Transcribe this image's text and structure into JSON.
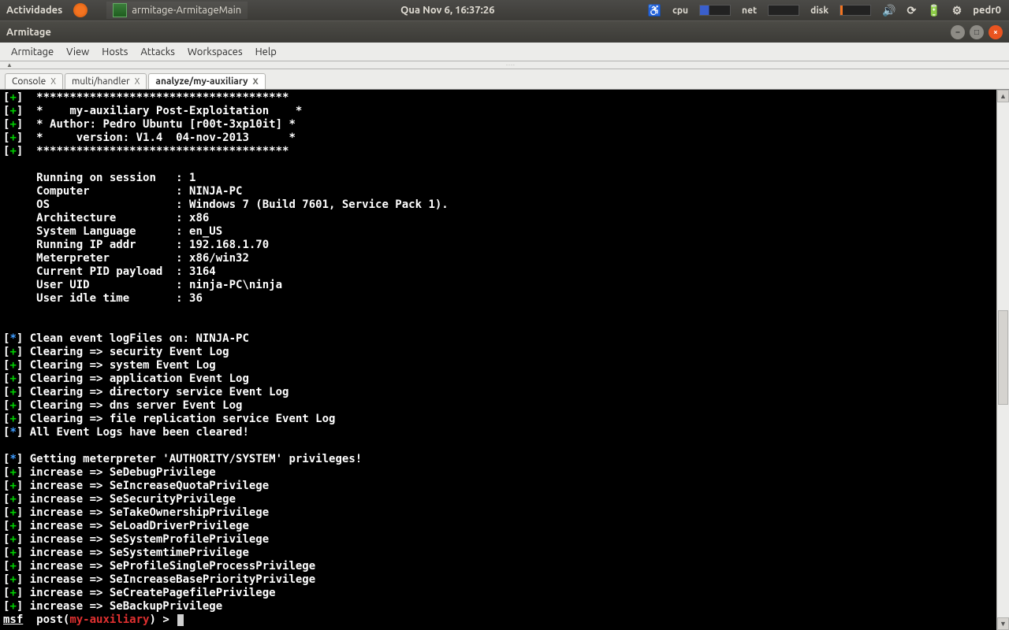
{
  "top_panel": {
    "activities": "Actividades",
    "taskbar_item": "armitage-ArmitageMain",
    "clock": "Qua Nov  6, 16:37:26",
    "cpu_label": "cpu",
    "net_label": "net",
    "disk_label": "disk",
    "username": "pedr0"
  },
  "window": {
    "title": "Armitage"
  },
  "menu": [
    "Armitage",
    "View",
    "Hosts",
    "Attacks",
    "Workspaces",
    "Help"
  ],
  "tabs": [
    {
      "label": "Console"
    },
    {
      "label": "multi/handler"
    },
    {
      "label": "analyze/my-auxiliary"
    }
  ],
  "console": {
    "banner_line1": "**************************************",
    "banner_title": "*    my-auxiliary Post-Exploitation    *",
    "banner_author": "* Author: Pedro Ubuntu [r00t-3xp10it] *",
    "banner_version": "*     version: V1.4  04-nov-2013      *",
    "banner_line2": "**************************************",
    "info": {
      "session": "Running on session   : 1",
      "computer": "Computer             : NINJA-PC",
      "os": "OS                   : Windows 7 (Build 7601, Service Pack 1).",
      "arch": "Architecture         : x86",
      "lang": "System Language      : en_US",
      "ip": "Running IP addr      : 192.168.1.70",
      "met": "Meterpreter          : x86/win32",
      "pid": "Current PID payload  : 3164",
      "uid": "User UID             : ninja-PC\\ninja",
      "idle": "User idle time       : 36"
    },
    "clean_title": "Clean event logFiles on: NINJA-PC",
    "clean_items": [
      "Clearing => security Event Log",
      "Clearing => system Event Log",
      "Clearing => application Event Log",
      "Clearing => directory service Event Log",
      "Clearing => dns server Event Log",
      "Clearing => file replication service Event Log"
    ],
    "clean_done": "All Event Logs have been cleared!",
    "priv_title": "Getting meterpreter 'AUTHORITY/SYSTEM' privileges!",
    "priv_items": [
      "increase => SeDebugPrivilege",
      "increase => SeIncreaseQuotaPrivilege",
      "increase => SeSecurityPrivilege",
      "increase => SeTakeOwnershipPrivilege",
      "increase => SeLoadDriverPrivilege",
      "increase => SeSystemProfilePrivilege",
      "increase => SeSystemtimePrivilege",
      "increase => SeProfileSingleProcessPrivilege",
      "increase => SeIncreaseBasePriorityPrivilege",
      "increase => SeCreatePagefilePrivilege",
      "increase => SeBackupPrivilege"
    ],
    "prompt_msf": "msf",
    "prompt_post": "post(",
    "prompt_aux": "my-auxiliary",
    "prompt_tail": ") > "
  }
}
